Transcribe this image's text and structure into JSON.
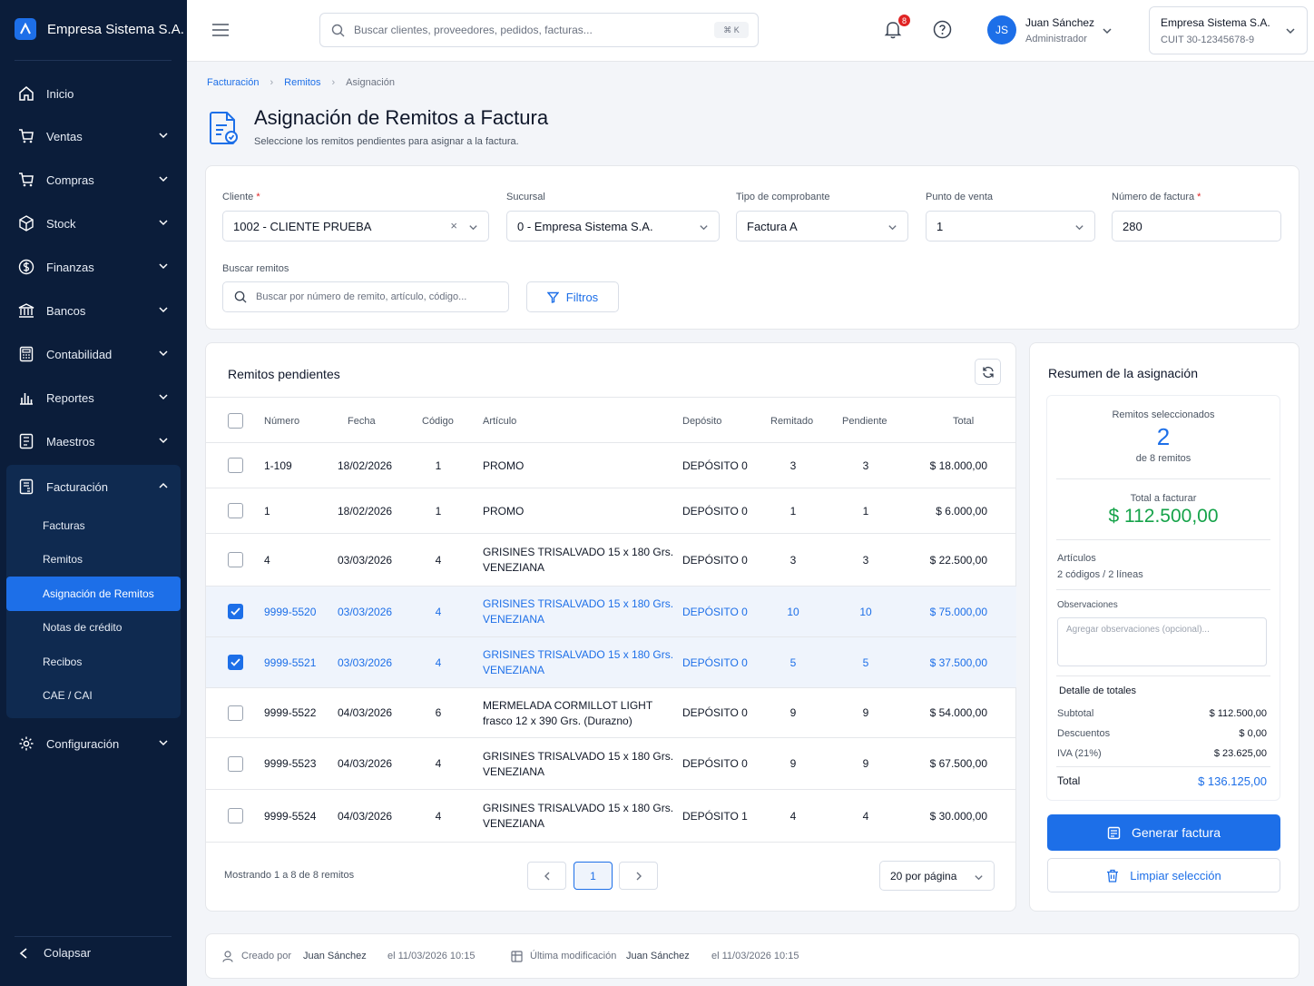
{
  "app": {
    "name": "Empresa Sistema S.A.",
    "logo_icon": "logo-icon"
  },
  "sidebar": {
    "items": [
      {
        "label": "Inicio",
        "icon": "home-icon"
      },
      {
        "label": "Ventas",
        "icon": "cart-icon"
      },
      {
        "label": "Compras",
        "icon": "cart-icon"
      },
      {
        "label": "Stock",
        "icon": "box-icon"
      },
      {
        "label": "Finanzas",
        "icon": "dollar-icon"
      },
      {
        "label": "Bancos",
        "icon": "bank-icon"
      },
      {
        "label": "Contabilidad",
        "icon": "calculator-icon"
      },
      {
        "label": "Reportes",
        "icon": "bar-chart-icon"
      },
      {
        "label": "Maestros",
        "icon": "book-icon"
      }
    ],
    "facturacion": {
      "label": "Facturación",
      "sub": [
        "Facturas",
        "Remitos",
        "Asignación de Remitos",
        "Notas de crédito",
        "Recibos",
        "CAE / CAI"
      ]
    },
    "config_label": "Configuración",
    "collapse_label": "Colapsar"
  },
  "topbar": {
    "search_placeholder": "Buscar clientes, proveedores, pedidos, facturas...",
    "shortcut": "⌘ K",
    "notifications": "8",
    "user": {
      "initials": "JS",
      "name": "Juan Sánchez",
      "role": "Administrador"
    },
    "company": {
      "name": "Empresa Sistema S.A.",
      "cuit": "CUIT 30-12345678-9"
    }
  },
  "breadcrumb": [
    "Facturación",
    "Remitos",
    "Asignación"
  ],
  "page": {
    "title": "Asignación de Remitos a Factura",
    "subtitle": "Seleccione los remitos pendientes para asignar a la factura."
  },
  "form": {
    "cliente": {
      "label": "Cliente",
      "value": "1002 - CLIENTE PRUEBA"
    },
    "sucursal": {
      "label": "Sucursal",
      "value": "0 - Empresa Sistema S.A."
    },
    "tipo": {
      "label": "Tipo de comprobante",
      "value": "Factura A"
    },
    "punto": {
      "label": "Punto de venta",
      "value": "1"
    },
    "numero": {
      "label": "Número de factura",
      "value": "280"
    },
    "buscar": {
      "label": "Buscar remitos",
      "placeholder": "Buscar por número de remito, artículo, código..."
    },
    "filtros_label": "Filtros",
    "required_mark": "*"
  },
  "table": {
    "title": "Remitos pendientes",
    "columns": [
      "Número",
      "Fecha",
      "Código",
      "Artículo",
      "Depósito",
      "Remitado",
      "Pendiente",
      "Total"
    ],
    "rows": [
      {
        "checked": false,
        "numero": "1-109",
        "fecha": "18/02/2026",
        "codigo": "1",
        "articulo": [
          "PROMO"
        ],
        "deposito": "DEPÓSITO 0",
        "remitado": "3",
        "pendiente": "3",
        "total": "$ 18.000,00"
      },
      {
        "checked": false,
        "numero": "1",
        "fecha": "18/02/2026",
        "codigo": "1",
        "articulo": [
          "PROMO"
        ],
        "deposito": "DEPÓSITO 0",
        "remitado": "1",
        "pendiente": "1",
        "total": "$ 6.000,00"
      },
      {
        "checked": false,
        "numero": "4",
        "fecha": "03/03/2026",
        "codigo": "4",
        "articulo": [
          "GRISINES TRISALVADO 15 x 180 Grs.",
          "VENEZIANA"
        ],
        "deposito": "DEPÓSITO 0",
        "remitado": "3",
        "pendiente": "3",
        "total": "$ 22.500,00"
      },
      {
        "checked": true,
        "numero": "9999-5520",
        "fecha": "03/03/2026",
        "codigo": "4",
        "articulo": [
          "GRISINES TRISALVADO 15 x 180 Grs.",
          "VENEZIANA"
        ],
        "deposito": "DEPÓSITO 0",
        "remitado": "10",
        "pendiente": "10",
        "total": "$ 75.000,00"
      },
      {
        "checked": true,
        "numero": "9999-5521",
        "fecha": "03/03/2026",
        "codigo": "4",
        "articulo": [
          "GRISINES TRISALVADO 15 x 180 Grs.",
          "VENEZIANA"
        ],
        "deposito": "DEPÓSITO 0",
        "remitado": "5",
        "pendiente": "5",
        "total": "$ 37.500,00"
      },
      {
        "checked": false,
        "numero": "9999-5522",
        "fecha": "04/03/2026",
        "codigo": "6",
        "articulo": [
          "MERMELADA CORMILLOT LIGHT",
          "frasco 12 x 390 Grs. (Durazno)"
        ],
        "deposito": "DEPÓSITO 0",
        "remitado": "9",
        "pendiente": "9",
        "total": "$ 54.000,00"
      },
      {
        "checked": false,
        "numero": "9999-5523",
        "fecha": "04/03/2026",
        "codigo": "4",
        "articulo": [
          "GRISINES TRISALVADO 15 x 180 Grs.",
          "VENEZIANA"
        ],
        "deposito": "DEPÓSITO 0",
        "remitado": "9",
        "pendiente": "9",
        "total": "$ 67.500,00"
      },
      {
        "checked": false,
        "numero": "9999-5524",
        "fecha": "04/03/2026",
        "codigo": "4",
        "articulo": [
          "GRISINES TRISALVADO 15 x 180 Grs.",
          "VENEZIANA"
        ],
        "deposito": "DEPÓSITO 1",
        "remitado": "4",
        "pendiente": "4",
        "total": "$ 30.000,00"
      }
    ],
    "footer": {
      "showing": "Mostrando 1 a 8 de 8 remitos",
      "page": "1",
      "per_page": "20 por página"
    }
  },
  "summary": {
    "title": "Resumen de la asignación",
    "selected_label": "Remitos seleccionados",
    "selected_count": "2",
    "of_total": "de 8 remitos",
    "total_label": "Total a facturar",
    "total_value": "$ 112.500,00",
    "articulos_label": "Artículos",
    "articulos_value": "2 códigos / 2 líneas",
    "obs_label": "Observaciones",
    "obs_placeholder": "Agregar observaciones (opcional)...",
    "detalle_label": "Detalle de totales",
    "subtotal_label": "Subtotal",
    "subtotal": "$ 112.500,00",
    "descuentos_label": "Descuentos",
    "descuentos": "$ 0,00",
    "iva_label": "IVA (21%)",
    "iva": "$ 23.625,00",
    "total_final_label": "Total",
    "total_final": "$ 136.125,00",
    "generar_label": "Generar factura",
    "limpiar_label": "Limpiar selección"
  },
  "audit": {
    "creado_label": "Creado por",
    "creado_user": "Juan Sánchez",
    "creado_date": "el 11/03/2026 10:15",
    "mod_label": "Última modificación",
    "mod_user": "Juan Sánchez",
    "mod_date": "el 11/03/2026 10:15"
  },
  "colors": {
    "sidebar": "#0b1d3a",
    "accent": "#1d6fe8",
    "success": "#16a34a",
    "danger": "#e02424"
  }
}
